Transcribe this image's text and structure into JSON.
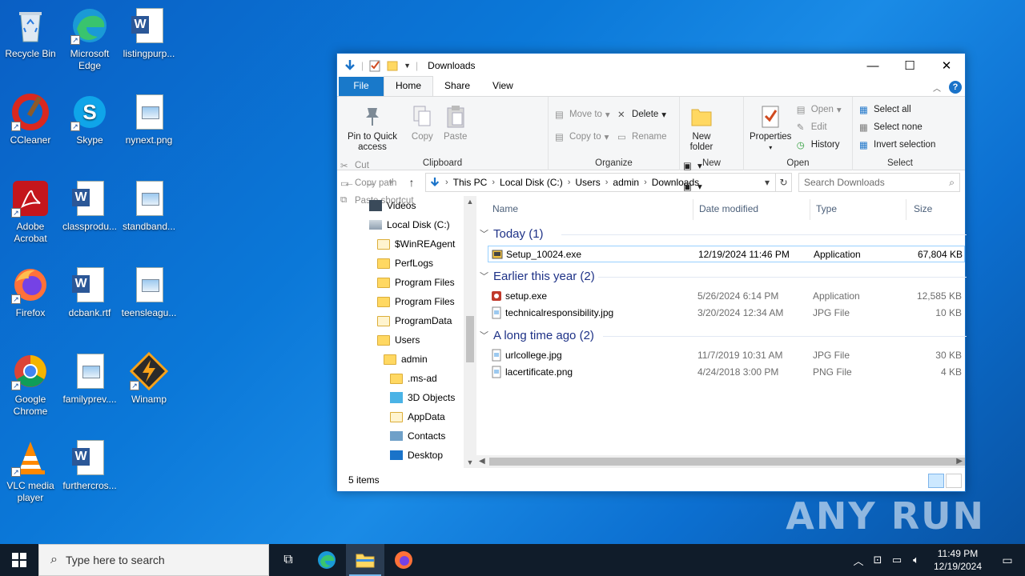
{
  "desktop": {
    "icons": [
      {
        "label": "Recycle Bin"
      },
      {
        "label": "Microsoft Edge"
      },
      {
        "label": "listingpurp..."
      },
      {
        "label": "CCleaner"
      },
      {
        "label": "Skype"
      },
      {
        "label": "nynext.png"
      },
      {
        "label": "Adobe Acrobat"
      },
      {
        "label": "classprodu..."
      },
      {
        "label": "standband..."
      },
      {
        "label": "Firefox"
      },
      {
        "label": "dcbank.rtf"
      },
      {
        "label": "teensleagu..."
      },
      {
        "label": "Google Chrome"
      },
      {
        "label": "familyprev...."
      },
      {
        "label": "Winamp"
      },
      {
        "label": "VLC media player"
      },
      {
        "label": "furthercros..."
      }
    ]
  },
  "window": {
    "title": "Downloads",
    "tabs": {
      "file": "File",
      "home": "Home",
      "share": "Share",
      "view": "View"
    },
    "ribbon": {
      "clipboard": {
        "label": "Clipboard",
        "pin": "Pin to Quick access",
        "copy": "Copy",
        "paste": "Paste",
        "cut": "Cut",
        "copy_path": "Copy path",
        "paste_shortcut": "Paste shortcut"
      },
      "organize": {
        "label": "Organize",
        "move_to": "Move to",
        "copy_to": "Copy to",
        "delete": "Delete",
        "rename": "Rename"
      },
      "new": {
        "label": "New",
        "new_folder": "New folder"
      },
      "open": {
        "label": "Open",
        "properties": "Properties",
        "open": "Open",
        "edit": "Edit",
        "history": "History"
      },
      "select": {
        "label": "Select",
        "select_all": "Select all",
        "select_none": "Select none",
        "invert": "Invert selection"
      }
    },
    "breadcrumb": [
      "This PC",
      "Local Disk (C:)",
      "Users",
      "admin",
      "Downloads"
    ],
    "search_placeholder": "Search Downloads",
    "tree": [
      {
        "label": "Videos"
      },
      {
        "label": "Local Disk (C:)"
      },
      {
        "label": "$WinREAgent"
      },
      {
        "label": "PerfLogs"
      },
      {
        "label": "Program Files"
      },
      {
        "label": "Program Files"
      },
      {
        "label": "ProgramData"
      },
      {
        "label": "Users"
      },
      {
        "label": "admin"
      },
      {
        "label": ".ms-ad"
      },
      {
        "label": "3D Objects"
      },
      {
        "label": "AppData"
      },
      {
        "label": "Contacts"
      },
      {
        "label": "Desktop"
      }
    ],
    "columns": {
      "name": "Name",
      "date": "Date modified",
      "type": "Type",
      "size": "Size"
    },
    "groups": [
      {
        "title": "Today (1)",
        "files": [
          {
            "name": "Setup_10024.exe",
            "date": "12/19/2024 11:46 PM",
            "type": "Application",
            "size": "67,804 KB"
          }
        ]
      },
      {
        "title": "Earlier this year (2)",
        "files": [
          {
            "name": "setup.exe",
            "date": "5/26/2024 6:14 PM",
            "type": "Application",
            "size": "12,585 KB"
          },
          {
            "name": "technicalresponsibility.jpg",
            "date": "3/20/2024 12:34 AM",
            "type": "JPG File",
            "size": "10 KB"
          }
        ]
      },
      {
        "title": "A long time ago (2)",
        "files": [
          {
            "name": "urlcollege.jpg",
            "date": "11/7/2019 10:31 AM",
            "type": "JPG File",
            "size": "30 KB"
          },
          {
            "name": "lacertificate.png",
            "date": "4/24/2018 3:00 PM",
            "type": "PNG File",
            "size": "4 KB"
          }
        ]
      }
    ],
    "status": "5 items"
  },
  "taskbar": {
    "search_placeholder": "Type here to search",
    "time": "11:49 PM",
    "date": "12/19/2024"
  },
  "watermark": "ANY RUN"
}
